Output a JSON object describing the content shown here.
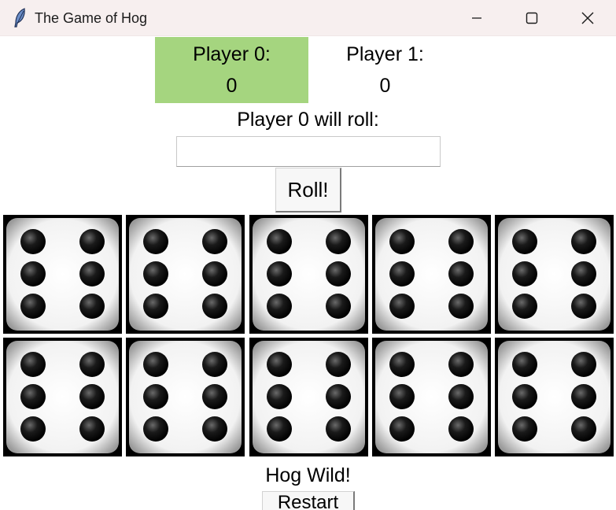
{
  "window": {
    "title": "The Game of Hog",
    "icon": "feather-icon",
    "controls": [
      "minimize-icon",
      "maximize-icon",
      "close-icon"
    ]
  },
  "players": [
    {
      "label": "Player 0:",
      "score": "0",
      "active": true
    },
    {
      "label": "Player 1:",
      "score": "0",
      "active": false
    }
  ],
  "active_color": "#a5d57f",
  "prompt": "Player 0 will roll:",
  "roll_input": {
    "value": "",
    "placeholder": ""
  },
  "roll_button": "Roll!",
  "dice": [
    6,
    6,
    6,
    6,
    6,
    6,
    6,
    6,
    6,
    6
  ],
  "status": "Hog Wild!",
  "restart_button": "Restart"
}
